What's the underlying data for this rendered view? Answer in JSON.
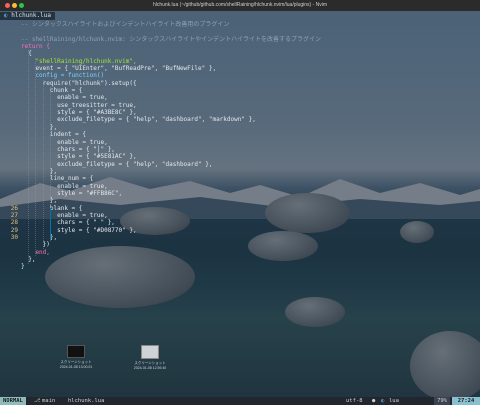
{
  "window": {
    "title": "hlchunk.lua (~/github/github.com/shellRaining/hlchunk.nvim/lua/plugins) - Nvim",
    "traffic_colors": [
      "#ff5f57",
      "#febc2e",
      "#28c840"
    ]
  },
  "tab": {
    "icon": "lua-file-icon",
    "label": "hlchunk.lua"
  },
  "editor": {
    "lines": [
      {
        "n": "",
        "text": "-- シンタックスハイライトおよびインデントハイライト改善用のプラグイン",
        "cls": "c-comment"
      },
      {
        "n": "",
        "text": "",
        "cls": "c-def"
      },
      {
        "n": "",
        "text": "-- shellRaining/hlchunk.nvim: シンタックスハイライトやインデントハイライトを改善するプラグイン",
        "cls": "c-comment"
      },
      {
        "n": "",
        "text": "return {",
        "cls": "c-kw"
      },
      {
        "n": "",
        "text": "  {",
        "cls": "c-def"
      },
      {
        "n": "",
        "text": "    \"shellRaining/hlchunk.nvim\",",
        "cls": "c-str"
      },
      {
        "n": "",
        "text": "    event = { \"UIEnter\", \"BufReadPre\", \"BufNewFile\" },",
        "cls": "c-def"
      },
      {
        "n": "",
        "text": "    config = function()",
        "cls": "c-fn"
      },
      {
        "n": "",
        "text": "      require(\"hlchunk\").setup({",
        "cls": "c-def"
      },
      {
        "n": "",
        "text": "        chunk = {",
        "cls": "c-def"
      },
      {
        "n": "",
        "text": "          enable = true,",
        "cls": "c-def"
      },
      {
        "n": "",
        "text": "          use_treesitter = true,",
        "cls": "c-def"
      },
      {
        "n": "",
        "text": "          style = { \"#A3BE8C\" },",
        "cls": "c-def"
      },
      {
        "n": "",
        "text": "          exclude_filetype = { \"help\", \"dashboard\", \"markdown\" },",
        "cls": "c-def"
      },
      {
        "n": "",
        "text": "        },",
        "cls": "c-def"
      },
      {
        "n": "",
        "text": "        indent = {",
        "cls": "c-def"
      },
      {
        "n": "",
        "text": "          enable = true,",
        "cls": "c-def"
      },
      {
        "n": "",
        "text": "          chars = { \"│\" },",
        "cls": "c-def"
      },
      {
        "n": "",
        "text": "          style = { \"#5E81AC\" },",
        "cls": "c-def"
      },
      {
        "n": "",
        "text": "          exclude_filetype = { \"help\", \"dashboard\" },",
        "cls": "c-def"
      },
      {
        "n": "",
        "text": "        },",
        "cls": "c-def"
      },
      {
        "n": "",
        "text": "        line_num = {",
        "cls": "c-def"
      },
      {
        "n": "",
        "text": "          enable = true,",
        "cls": "c-def"
      },
      {
        "n": "",
        "text": "          style = \"#FFB86C\",",
        "cls": "c-def"
      },
      {
        "n": "",
        "text": "        },",
        "cls": "c-def"
      },
      {
        "n": "26",
        "text": "        blank = {",
        "cls": "c-def"
      },
      {
        "n": "27",
        "text": "          enable = true,",
        "cls": "c-def"
      },
      {
        "n": "28",
        "text": "          chars = { \" \" },",
        "cls": "c-def"
      },
      {
        "n": "29",
        "text": "          style = { \"#D08770\" },",
        "cls": "c-def"
      },
      {
        "n": "30",
        "text": "        },",
        "cls": "c-def"
      },
      {
        "n": "",
        "text": "      })",
        "cls": "c-def"
      },
      {
        "n": "",
        "text": "    end,",
        "cls": "c-kw"
      },
      {
        "n": "",
        "text": "  },",
        "cls": "c-def"
      },
      {
        "n": "",
        "text": "}",
        "cls": "c-def"
      }
    ]
  },
  "desktop_icons": [
    {
      "label": "スクリーンショット 2024-01-08 13.00.01",
      "icon": "screenshot-file-icon"
    },
    {
      "label": "スクリーンショット 2024-01-08 12.59.40",
      "icon": "screenshot-file-icon"
    }
  ],
  "status": {
    "mode": "NORMAL",
    "branch_icon": "git-branch-icon",
    "branch": "main",
    "file": "hlchunk.lua",
    "encoding": "utf-8",
    "os_icon": "apple-icon",
    "filetype": "lua",
    "percent": "79%",
    "position": "27:24"
  }
}
